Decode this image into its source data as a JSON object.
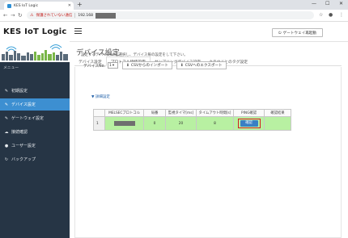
{
  "browser": {
    "tab_title": "KES IoT Logic",
    "insecure_label": "保護されていない通信",
    "url_prefix": "192.168"
  },
  "sidebar": {
    "logo": "KES IoT Logic",
    "menu_header": "メニュー",
    "items": [
      {
        "label": "初期設定",
        "icon": "wrench-icon"
      },
      {
        "label": "デバイス設定",
        "icon": "edit-icon",
        "active": true
      },
      {
        "label": "ゲートウェイ設定",
        "icon": "edit-icon"
      },
      {
        "label": "接続確認",
        "icon": "cloud-icon"
      },
      {
        "label": "ユーザー設定",
        "icon": "user-icon"
      },
      {
        "label": "バックアップ",
        "icon": "refresh-icon"
      }
    ]
  },
  "header": {
    "gateway_restart": "ゲートウェイ再起動"
  },
  "page": {
    "title": "デバイス設定",
    "tabs": [
      {
        "label": "デバイス設定",
        "active": false
      },
      {
        "label": "プロトコル接続設定",
        "active": true
      },
      {
        "label": "サンプリングデバイス設定",
        "active": false
      },
      {
        "label": "クラウドとのタグ設定",
        "active": false
      }
    ],
    "description": "設定するデバイスNoを選択し、デバイス毎の設定をして下さい。",
    "device_no_label": "デバイスNo.",
    "device_no_value": "1",
    "import_btn": "CSVからのインポート",
    "export_btn": "CSVへのエクスポート",
    "detail_link": "▼ 詳細設定"
  },
  "table": {
    "columns": [
      "",
      "MELSECプロトコル",
      "局番",
      "監視タイマ[ms]",
      "タイムアウト時間[s]",
      "PING確認",
      "確認結果"
    ],
    "rows": [
      {
        "index": "1",
        "protocol": "",
        "station": "0",
        "timer": "20",
        "timeout": "8",
        "ping_btn": "確認",
        "result": ""
      }
    ]
  },
  "colors": {
    "sidebar_bg": "#263545",
    "active_item": "#3d8fd1",
    "row_green": "#b8f0a2",
    "highlight_red": "#d21d1d"
  }
}
